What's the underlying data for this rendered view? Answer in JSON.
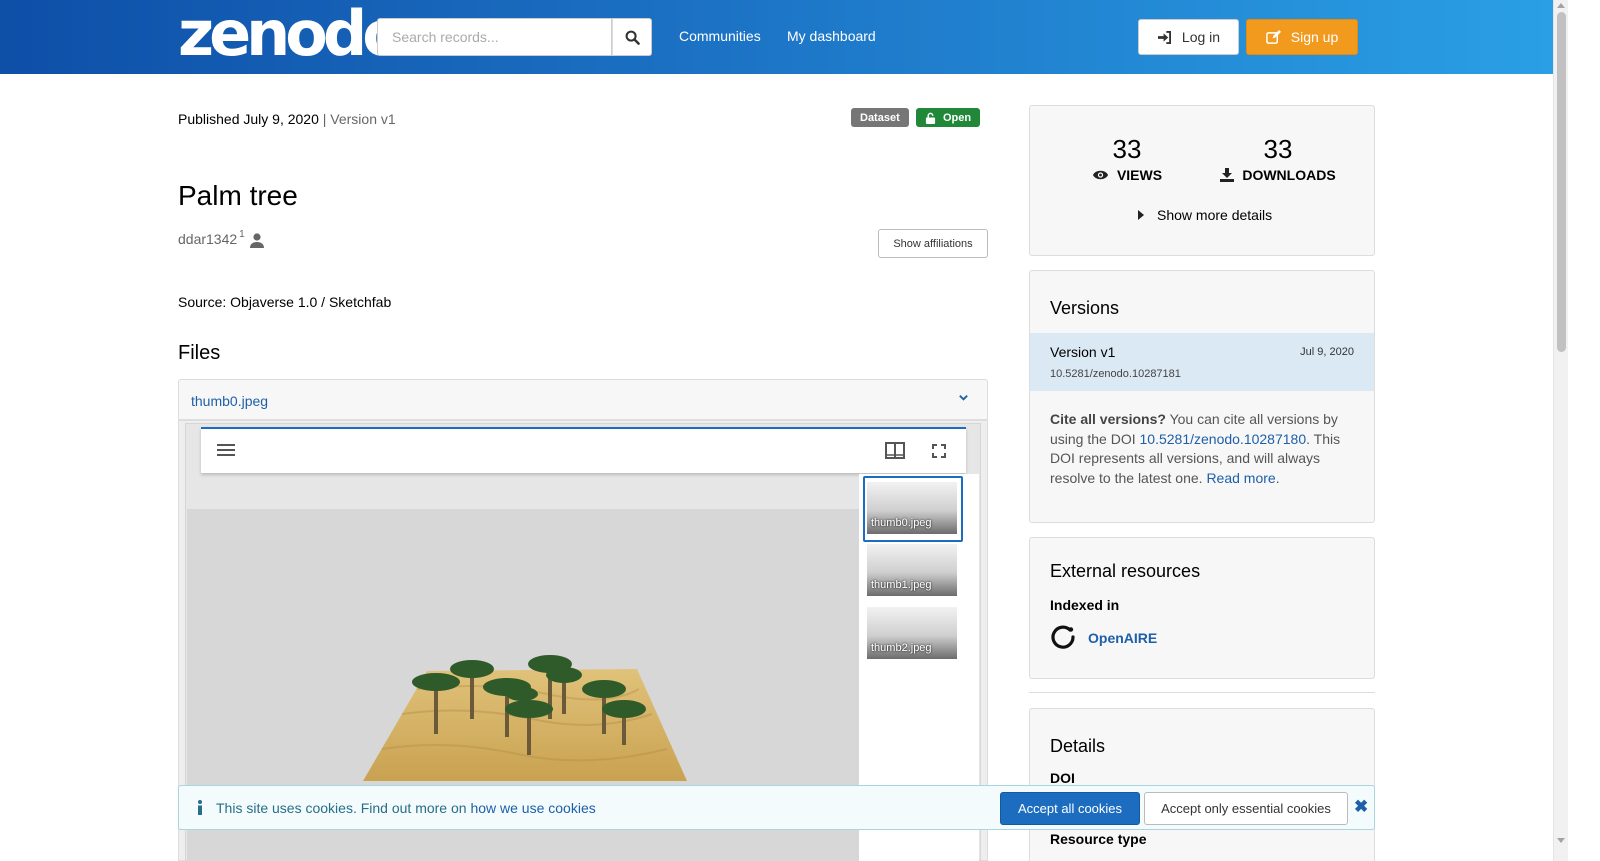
{
  "header": {
    "logo_text": "zenodo",
    "search_placeholder": "Search records...",
    "nav": [
      "Communities",
      "My dashboard"
    ],
    "login_label": "Log in",
    "signup_label": "Sign up"
  },
  "record": {
    "published": "Published July 9, 2020",
    "version": "| Version v1",
    "badges": [
      "Dataset",
      "Open"
    ],
    "title": "Palm tree",
    "creator": "ddar1342",
    "creator_affiliation_sup": "1",
    "show_affiliations_label": "Show affiliations",
    "source": "Source: Objaverse 1.0 / Sketchfab"
  },
  "files": {
    "heading": "Files",
    "open_file": "thumb0.jpeg",
    "thumbnails": [
      "thumb0.jpeg",
      "thumb1.jpeg",
      "thumb2.jpeg"
    ]
  },
  "stats": {
    "views_count": "33",
    "views_label": "VIEWS",
    "downloads_count": "33",
    "downloads_label": "DOWNLOADS",
    "more_details_label": "Show more details"
  },
  "versions": {
    "title": "Versions",
    "current": {
      "name": "Version v1",
      "date": "Jul 9, 2020",
      "doi": "10.5281/zenodo.10287181"
    },
    "cite_bold": "Cite all versions?",
    "cite_text_1": " You can cite all versions by using the DOI ",
    "cite_doi": "10.5281/zenodo.10287180",
    "cite_text_2": ". This DOI represents all versions, and will always resolve to the latest one. ",
    "read_more": "Read more"
  },
  "external": {
    "title": "External resources",
    "indexed_in": "Indexed in",
    "openaire": "OpenAIRE"
  },
  "details": {
    "title": "Details",
    "doi_label": "DOI",
    "resource_type_label": "Resource type"
  },
  "cookies": {
    "text": "This site uses cookies. Find out more on ",
    "link": "how we use cookies",
    "accept_all": "Accept all cookies",
    "accept_essential": "Accept only essential cookies",
    "close_symbol": "✖"
  },
  "colors": {
    "header_start": "#0e4fa8",
    "header_end": "#2aa0e6",
    "signup": "#f29a1e",
    "open_badge": "#21883a",
    "link": "#1e5fa8"
  }
}
